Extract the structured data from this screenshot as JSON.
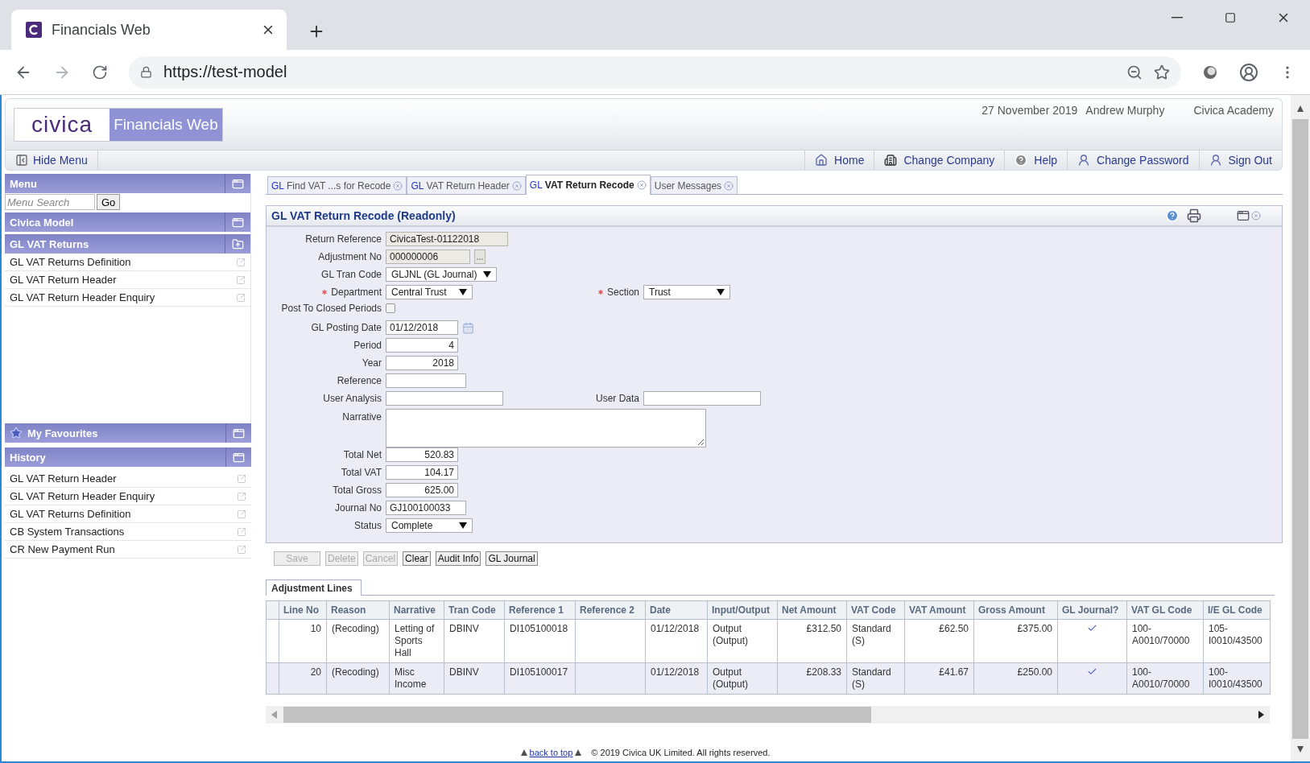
{
  "browser": {
    "tab_title": "Financials Web",
    "url": "https://test-model"
  },
  "header": {
    "logo": "civica",
    "product": "Financials Web",
    "date": "27 November 2019",
    "user": "Andrew Murphy",
    "company": "Civica Academy"
  },
  "toolbar": {
    "hide_menu": "Hide Menu",
    "links": [
      {
        "label": "Home",
        "kind": "home"
      },
      {
        "label": "Change Company",
        "kind": "company"
      },
      {
        "label": "Help",
        "kind": "help"
      },
      {
        "label": "Change Password",
        "kind": "user"
      },
      {
        "label": "Sign Out",
        "kind": "user"
      }
    ]
  },
  "sidebar": {
    "menu_title": "Menu",
    "search_placeholder": "Menu Search",
    "go": "Go",
    "model": "Civica Model",
    "section": "GL VAT Returns",
    "items": [
      "GL VAT Returns Definition",
      "GL VAT Return Header",
      "GL VAT Return Header Enquiry"
    ],
    "favourites": "My Favourites",
    "history_title": "History",
    "history": [
      "GL VAT Return Header",
      "GL VAT Return Header Enquiry",
      "GL VAT Returns Definition",
      "CB System Transactions",
      "CR New Payment Run"
    ]
  },
  "tabs": [
    {
      "prefix": "GL",
      "label": "Find VAT ...s for Recode",
      "selected": false
    },
    {
      "prefix": "GL",
      "label": "VAT Return Header",
      "selected": false
    },
    {
      "prefix": "GL",
      "label": "VAT Return Recode",
      "selected": true
    },
    {
      "label": "User Messages",
      "selected": false
    }
  ],
  "panel": {
    "title": "GL VAT Return Recode (Readonly)",
    "rows": [
      [
        {
          "label": "Return Reference",
          "kind": "text",
          "value": "CivicaTest-01122018",
          "readonly": true
        }
      ],
      [
        {
          "label": "Adjustment No",
          "kind": "lookup",
          "value": "000000006",
          "readonly": true
        }
      ],
      [
        {
          "label": "GL Tran Code",
          "kind": "select",
          "value": "GLJNL (GL Journal)"
        }
      ],
      [
        {
          "label": "Department",
          "kind": "select",
          "value": "Central Trust",
          "required": true
        },
        {
          "label": "Section",
          "kind": "select",
          "value": "Trust",
          "required": true
        }
      ],
      [
        {
          "label": "Post To Closed Periods",
          "kind": "checkbox",
          "checked": false
        }
      ],
      [
        {
          "label": "GL Posting Date",
          "kind": "date",
          "value": "01/12/2018"
        }
      ],
      [
        {
          "label": "Period",
          "kind": "number",
          "value": "4"
        }
      ],
      [
        {
          "label": "Year",
          "kind": "number",
          "value": "2018"
        }
      ],
      [
        {
          "label": "Reference",
          "kind": "text"
        }
      ],
      [
        {
          "label": "User Analysis",
          "kind": "text"
        },
        {
          "label": "User Data",
          "kind": "text"
        }
      ],
      [
        {
          "label": "Narrative",
          "kind": "textarea"
        }
      ],
      [
        {
          "label": "Total Net",
          "kind": "number",
          "value": "520.83"
        }
      ],
      [
        {
          "label": "Total VAT",
          "kind": "number",
          "value": "104.17"
        }
      ],
      [
        {
          "label": "Total Gross",
          "kind": "number",
          "value": "625.00"
        }
      ],
      [
        {
          "label": "Journal No",
          "kind": "text",
          "value": "GJ100100033"
        }
      ],
      [
        {
          "label": "Status",
          "kind": "select",
          "value": "Complete"
        }
      ]
    ]
  },
  "buttons": [
    {
      "label": "Save",
      "disabled": true
    },
    {
      "label": "Delete",
      "disabled": true
    },
    {
      "label": "Cancel",
      "disabled": true
    },
    {
      "label": "Clear",
      "disabled": false
    },
    {
      "label": "Audit Info",
      "disabled": false
    },
    {
      "label": "GL Journal",
      "disabled": false
    }
  ],
  "lines": {
    "tab": "Adjustment Lines",
    "columns": [
      {
        "label": "Line No",
        "kind": "number"
      },
      {
        "label": "Reason",
        "kind": "text"
      },
      {
        "label": "Narrative",
        "kind": "text"
      },
      {
        "label": "Tran Code",
        "kind": "text"
      },
      {
        "label": "Reference 1",
        "kind": "text"
      },
      {
        "label": "Reference 2",
        "kind": "text"
      },
      {
        "label": "Date",
        "kind": "text"
      },
      {
        "label": "Input/Output",
        "kind": "text"
      },
      {
        "label": "Net Amount",
        "kind": "number"
      },
      {
        "label": "VAT Code",
        "kind": "text"
      },
      {
        "label": "VAT Amount",
        "kind": "number"
      },
      {
        "label": "Gross Amount",
        "kind": "number"
      },
      {
        "label": "GL Journal?",
        "kind": "check"
      },
      {
        "label": "VAT GL Code",
        "kind": "text"
      },
      {
        "label": "I/E GL Code",
        "kind": "text"
      }
    ],
    "rows": [
      {
        "cells": [
          "10",
          "(Recoding)",
          "Letting of Sports Hall",
          "DBINV",
          "DI105100018",
          "",
          "01/12/2018",
          "Output (Output)",
          "£312.50",
          "Standard (S)",
          "£62.50",
          "£375.00",
          true,
          "100-A0010/70000",
          "105-I0010/43500"
        ]
      },
      {
        "cells": [
          "20",
          "(Recoding)",
          "Misc Income",
          "DBINV",
          "DI105100017",
          "",
          "01/12/2018",
          "Output (Output)",
          "£208.33",
          "Standard (S)",
          "£41.67",
          "£250.00",
          true,
          "100-A0010/70000",
          "100-I0010/43500"
        ]
      }
    ]
  },
  "footer": {
    "back_to_top": "back to top",
    "copyright": "© 2019 Civica UK Limited. All rights reserved."
  }
}
